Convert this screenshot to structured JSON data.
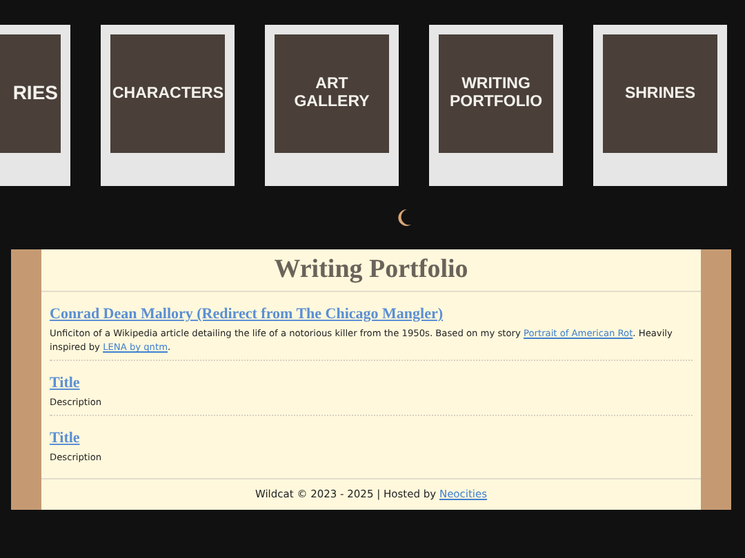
{
  "nav_polaroids": [
    {
      "label": "RIES",
      "clipped": true
    },
    {
      "label": "CHARACTERS",
      "clipped": false
    },
    {
      "label": "ART GALLERY",
      "clipped": false
    },
    {
      "label": "WRITING PORTFOLIO",
      "clipped": false
    },
    {
      "label": "SHRINES",
      "clipped": false
    }
  ],
  "panel": {
    "title": "Writing Portfolio",
    "entries": [
      {
        "title": "Conrad Dean Mallory (Redirect from The Chicago Mangler)",
        "description": [
          {
            "text": "Unficiton of a Wikipedia article detailing the life of a notorious killer from the 1950s. Based on my story "
          },
          {
            "link": "Portrait of American Rot"
          },
          {
            "text": ". Heavily inspired by "
          },
          {
            "link": "LENA by qntm"
          },
          {
            "text": "."
          }
        ]
      },
      {
        "title": "Title",
        "description": [
          {
            "text": "Description"
          }
        ]
      },
      {
        "title": "Title",
        "description": [
          {
            "text": "Description"
          }
        ]
      }
    ],
    "footer": {
      "text": "Wildcat © 2023 - 2025 | Hosted by ",
      "link": "Neocities"
    }
  }
}
